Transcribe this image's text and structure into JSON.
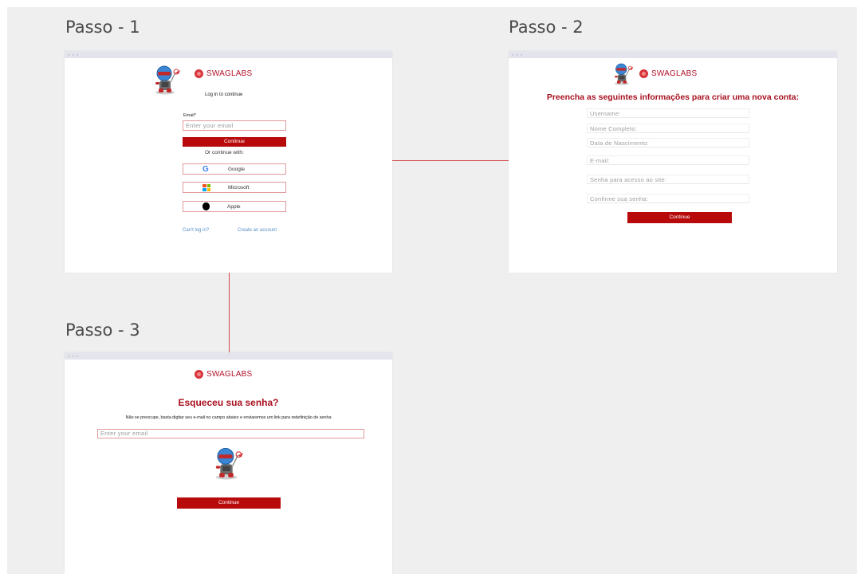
{
  "steps": [
    {
      "title": "Passo - 1"
    },
    {
      "title": "Passo - 2"
    },
    {
      "title": "Passo - 3"
    }
  ],
  "brand": "SWAGLABS",
  "step1": {
    "subtitle": "Log in to continue",
    "email_label": "Email*",
    "email_placeholder": "Enter your email",
    "continue_label": "Continue",
    "or_continue": "Or continue with:",
    "social": [
      {
        "label": "Google",
        "icon": "google-icon"
      },
      {
        "label": "Microsoft",
        "icon": "microsoft-icon"
      },
      {
        "label": "Apple",
        "icon": "apple-icon"
      }
    ],
    "cant_login": "Can't log in?",
    "create_account": "Create an account"
  },
  "step2": {
    "heading": "Preencha as seguintes informações para criar uma nova conta:",
    "fields": [
      "Username:",
      "Nome Completo:",
      "Data de Nascimento:",
      "E-mail:",
      "Senha para acesso ao site:",
      "Confirme sua senha:"
    ],
    "continue_label": "Continue"
  },
  "step3": {
    "heading": "Esqueceu sua senha?",
    "description": "Não se preocupe, basta digitar seu e-mail no campo abaixo e enviaremos um link para redefinição de senha",
    "email_placeholder": "Enter your email",
    "continue_label": "Continue"
  },
  "colors": {
    "accent": "#b80a0a",
    "heading": "#a8101f",
    "connector": "#d24a4a",
    "canvas": "#efefef"
  }
}
